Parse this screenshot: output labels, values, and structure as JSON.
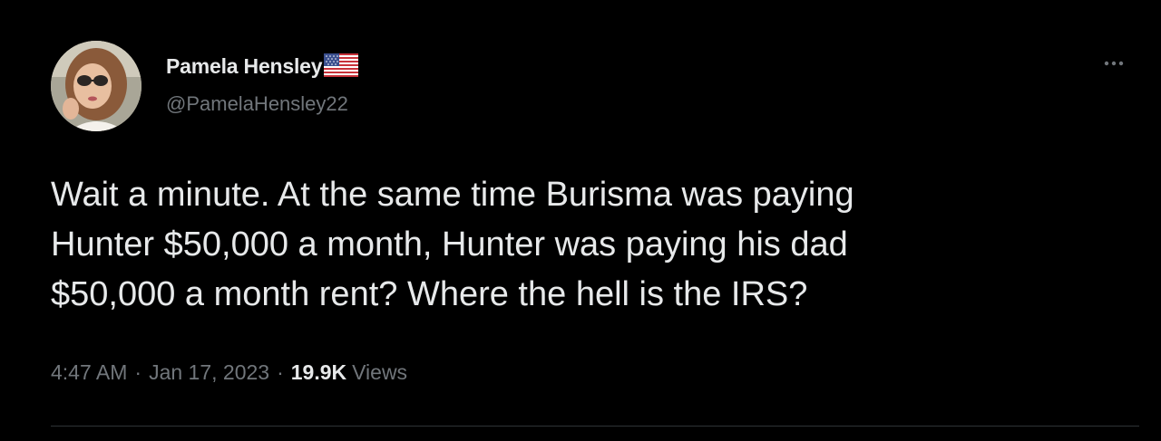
{
  "author": {
    "display_name": "Pamela Hensley",
    "badge_icon": "us-flag-icon",
    "handle": "@PamelaHensley22"
  },
  "tweet": {
    "text": "Wait a minute. At the same time Burisma was paying\nHunter $50,000 a month, Hunter was paying his dad\n$50,000 a month rent?  Where the hell is the IRS?"
  },
  "meta": {
    "time": "4:47 AM",
    "separator": "·",
    "date": "Jan 17, 2023",
    "views_count": "19.9K",
    "views_label": "Views"
  },
  "icons": {
    "more": "more-options-icon"
  },
  "colors": {
    "background": "#000000",
    "primary_text": "#e7e9ea",
    "secondary_text": "#71767b",
    "divider": "#2f3336"
  }
}
